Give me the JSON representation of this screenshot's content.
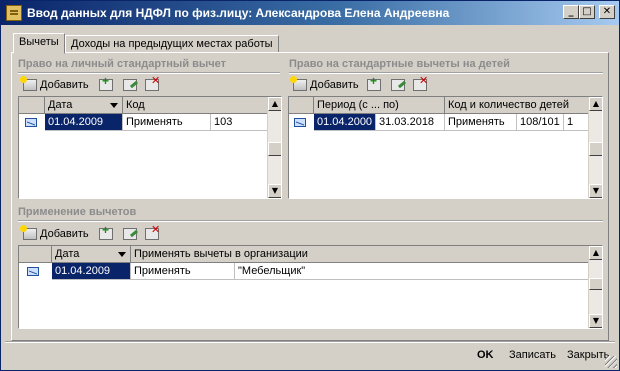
{
  "window": {
    "title": "Ввод данных для НДФЛ по физ.лицу: Александрова Елена Андреевна"
  },
  "title_buttons": {
    "minimize": "_",
    "maximize": "□",
    "close": "✕"
  },
  "tabs": [
    {
      "label": "Вычеты",
      "active": true
    },
    {
      "label": "Доходы на предыдущих местах работы",
      "active": false
    }
  ],
  "personal": {
    "title": "Право на личный стандартный вычет",
    "add_label": "Добавить",
    "columns": [
      "Дата",
      "Код"
    ],
    "rows": [
      {
        "date": "01.04.2009",
        "action": "Применять",
        "code": "103"
      }
    ]
  },
  "children": {
    "title": "Право на стандартные вычеты на детей",
    "add_label": "Добавить",
    "columns": [
      "Период (с ... по)",
      "Код и количество детей"
    ],
    "rows": [
      {
        "from": "01.04.2000",
        "to": "31.03.2018",
        "action": "Применять",
        "code": "108/101",
        "count": "1"
      }
    ]
  },
  "application": {
    "title": "Применение вычетов",
    "add_label": "Добавить",
    "columns": [
      "Дата",
      "Применять вычеты в организации"
    ],
    "rows": [
      {
        "date": "01.04.2009",
        "action": "Применять",
        "org": "\"Мебельщик\""
      }
    ]
  },
  "footer": {
    "ok": "OK",
    "save": "Записать",
    "close": "Закрыть"
  },
  "colors": {
    "selection": "#0a246a",
    "titlebar_start": "#0a246a",
    "titlebar_end": "#a6caf0",
    "face": "#d4d0c8"
  }
}
